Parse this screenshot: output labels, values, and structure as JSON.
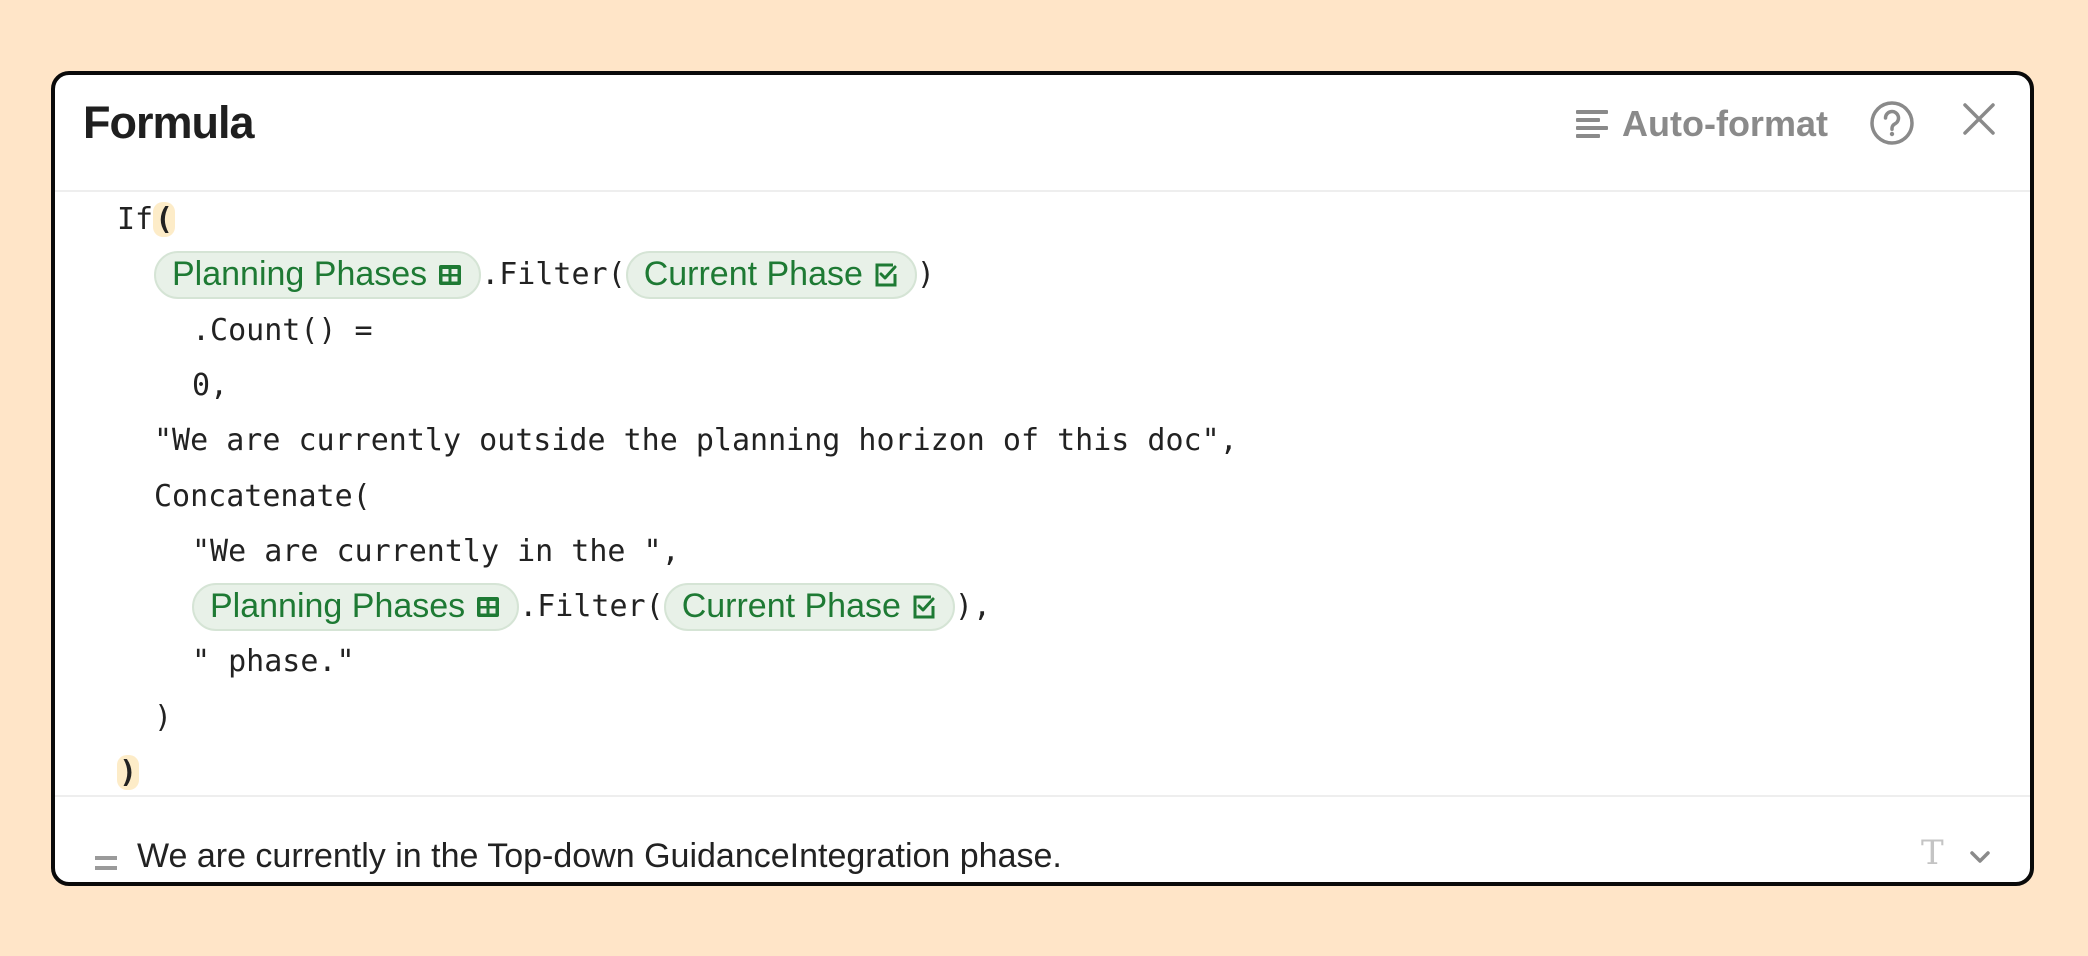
{
  "dialog": {
    "title": "Formula",
    "autoformat_label": "Auto-format",
    "icons": {
      "autoformat": "align-left-icon",
      "help": "help-circle-icon",
      "close": "close-icon"
    }
  },
  "code": {
    "lines": [
      {
        "indent": 0,
        "parts": [
          {
            "t": "text",
            "v": "If"
          },
          {
            "t": "paren",
            "v": "("
          }
        ]
      },
      {
        "indent": 1,
        "parts": [
          {
            "t": "chip",
            "v": "Planning Phases",
            "icon": "table"
          },
          {
            "t": "text",
            "v": ".Filter("
          },
          {
            "t": "chip",
            "v": "Current Phase",
            "icon": "checkbox"
          },
          {
            "t": "text",
            "v": ")"
          }
        ]
      },
      {
        "indent": 2,
        "parts": [
          {
            "t": "text",
            "v": ".Count() ="
          }
        ]
      },
      {
        "indent": 2,
        "parts": [
          {
            "t": "text",
            "v": "0,"
          }
        ]
      },
      {
        "indent": 1,
        "parts": [
          {
            "t": "text",
            "v": "\"We are currently outside the planning horizon of this doc\","
          }
        ]
      },
      {
        "indent": 1,
        "parts": [
          {
            "t": "text",
            "v": "Concatenate("
          }
        ]
      },
      {
        "indent": 2,
        "parts": [
          {
            "t": "text",
            "v": "\"We are currently in the \","
          }
        ]
      },
      {
        "indent": 2,
        "parts": [
          {
            "t": "chip",
            "v": "Planning Phases",
            "icon": "table"
          },
          {
            "t": "text",
            "v": ".Filter("
          },
          {
            "t": "chip",
            "v": "Current Phase",
            "icon": "checkbox"
          },
          {
            "t": "text",
            "v": "),"
          }
        ]
      },
      {
        "indent": 2,
        "parts": [
          {
            "t": "text",
            "v": "\" phase.\""
          }
        ]
      },
      {
        "indent": 1,
        "parts": [
          {
            "t": "text",
            "v": ")"
          }
        ]
      },
      {
        "indent": 0,
        "parts": [
          {
            "t": "paren",
            "v": ")"
          }
        ]
      }
    ]
  },
  "result": {
    "prefix_icon": "equals-icon",
    "value": "We are currently in the Top-down GuidanceIntegration phase.",
    "type_icon_glyph": "T",
    "type_icon": "text-type-icon",
    "dropdown_icon": "chevron-down-icon"
  },
  "colors": {
    "background": "#ffe5c8",
    "chip_text": "#1e7a34",
    "chip_bg": "#e8f1e8",
    "paren_highlight": "#fdecc8",
    "muted": "#8a8a8a"
  }
}
